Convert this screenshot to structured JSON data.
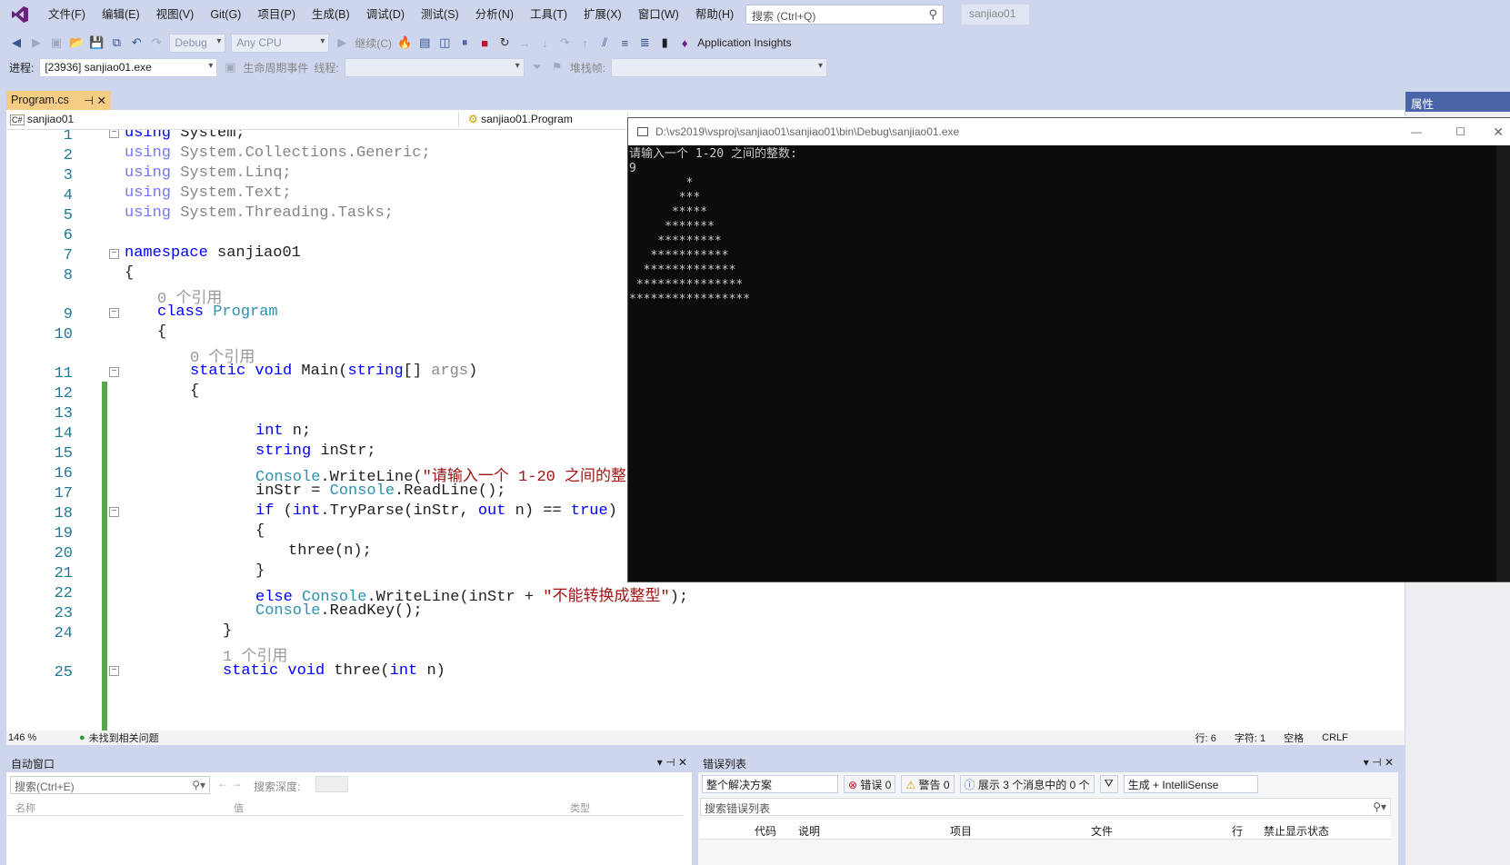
{
  "menubar": {
    "items": [
      "文件(F)",
      "编辑(E)",
      "视图(V)",
      "Git(G)",
      "项目(P)",
      "生成(B)",
      "调试(D)",
      "测试(S)",
      "分析(N)",
      "工具(T)",
      "扩展(X)",
      "窗口(W)",
      "帮助(H)"
    ],
    "search_placeholder": "搜索 (Ctrl+Q)",
    "solution_name": "sanjiao01"
  },
  "toolbar1": {
    "config": "Debug",
    "platform": "Any CPU",
    "continue_label": "继续(C)",
    "app_insights": "Application Insights"
  },
  "toolbar2": {
    "process_label": "进程:",
    "process_value": "[23936] sanjiao01.exe",
    "lifecycle_label": "生命周期事件",
    "thread_label": "线程:",
    "stackframe_label": "堆栈帧:"
  },
  "editor": {
    "tab_label": "Program.cs",
    "nav_project": "sanjiao01",
    "nav_class": "sanjiao01.Program",
    "codelens_0ref": "0 个引用",
    "codelens_1ref": "1 个引用",
    "line_numbers": [
      "1",
      "2",
      "3",
      "4",
      "5",
      "6",
      "7",
      "8",
      "9",
      "10",
      "11",
      "12",
      "13",
      "14",
      "15",
      "16",
      "17",
      "18",
      "19",
      "20",
      "21",
      "22",
      "23",
      "24",
      "25"
    ],
    "status": {
      "zoom": "146 %",
      "issues": "未找到相关问题",
      "line": "行: 6",
      "char": "字符: 1",
      "spaces": "空格",
      "eol": "CRLF"
    }
  },
  "console": {
    "title": "D:\\vs2019\\vsproj\\sanjiao01\\sanjiao01\\bin\\Debug\\sanjiao01.exe",
    "lines": [
      "请输入一个 1-20 之间的整数:",
      "9",
      "        *",
      "       ***",
      "      *****",
      "     *******",
      "    *********",
      "   ***********",
      "  *************",
      " ***************",
      "*****************"
    ]
  },
  "properties": {
    "title": "属性"
  },
  "autos": {
    "title": "自动窗口",
    "search_placeholder": "搜索(Ctrl+E)",
    "depth_label": "搜索深度:",
    "columns": [
      "名称",
      "值",
      "类型"
    ]
  },
  "errors": {
    "title": "错误列表",
    "scope": "整个解决方案",
    "errors_btn": "错误 0",
    "warnings_btn": "警告 0",
    "messages_btn": "展示 3 个消息中的 0 个",
    "build_filter": "生成 + IntelliSense",
    "search_placeholder": "搜索错误列表",
    "columns": [
      "代码",
      "说明",
      "项目",
      "文件",
      "行",
      "禁止显示状态"
    ]
  }
}
